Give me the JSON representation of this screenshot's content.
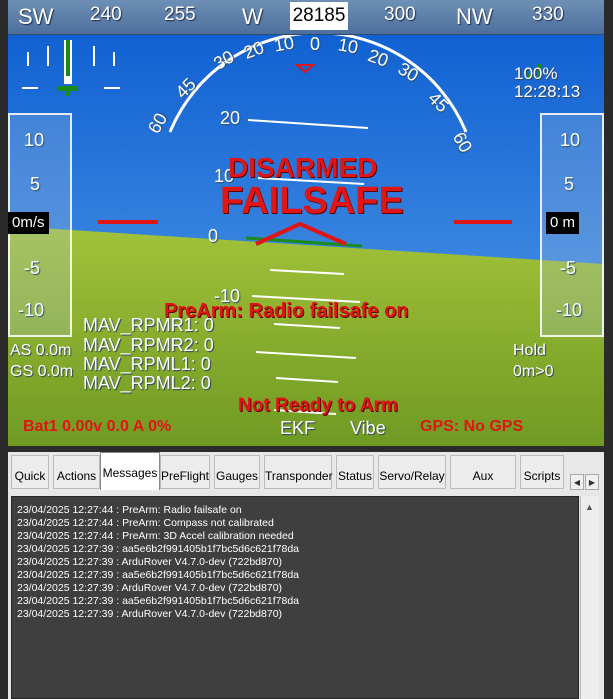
{
  "heading": {
    "labels": [
      "SW",
      "240",
      "255",
      "W",
      "300",
      "NW",
      "330"
    ],
    "current": "28185"
  },
  "pitch_labels": [
    "20",
    "10",
    "0",
    "-10"
  ],
  "roll_labels": [
    "60",
    "45",
    "30",
    "20",
    "10",
    "0",
    "10",
    "20",
    "30",
    "45",
    "60"
  ],
  "speed_scale": {
    "ticks": [
      "10",
      "5",
      "-5",
      "-10"
    ],
    "value": "0m/s"
  },
  "alt_scale": {
    "ticks": [
      "10",
      "5",
      "-5",
      "-10"
    ],
    "value": "0 m"
  },
  "battery_signal": {
    "percent": "100%",
    "time": "12:28:13"
  },
  "status": {
    "disarmed": "DISARMED",
    "failsafe": "FAILSAFE",
    "prearm": "PreArm: Radio failsafe on",
    "not_ready": "Not Ready to Arm",
    "battery": "Bat1 0.00v 0.0 A 0%",
    "gps": "GPS: No GPS",
    "ekf": "EKF",
    "vibe": "Vibe"
  },
  "left_readouts": {
    "as": "AS 0.0m",
    "gs": "GS 0.0m"
  },
  "right_readouts": {
    "mode": "Hold",
    "wp": "0m>0"
  },
  "rpm": [
    "MAV_RPMR1: 0",
    "MAV_RPMR2: 0",
    "MAV_RPML1: 0",
    "MAV_RPML2: 0"
  ],
  "tabs": [
    "Quick",
    "Actions",
    "Messages",
    "PreFlight",
    "Gauges",
    "Transponder",
    "Status",
    "Servo/Relay",
    "Aux Function",
    "Scripts"
  ],
  "active_tab": "Messages",
  "messages": [
    "23/04/2025 12:27:44 : PreArm: Radio failsafe on",
    "23/04/2025 12:27:44 : PreArm: Compass not calibrated",
    "23/04/2025 12:27:44 : PreArm: 3D Accel calibration needed",
    "23/04/2025 12:27:39 : aa5e6b2f991405b1f7bc5d6c621f78da",
    "23/04/2025 12:27:39 : ArduRover V4.7.0-dev (722bd870)",
    "23/04/2025 12:27:39 : aa5e6b2f991405b1f7bc5d6c621f78da",
    "23/04/2025 12:27:39 : ArduRover V4.7.0-dev (722bd870)",
    "23/04/2025 12:27:39 : aa5e6b2f991405b1f7bc5d6c621f78da",
    "23/04/2025 12:27:39 : ArduRover V4.7.0-dev (722bd870)"
  ],
  "colors": {
    "sky_top": "#1f6fcf",
    "ground": "#8fb52f",
    "alert_red": "#e01515",
    "heading_bar": "#5a7fab"
  }
}
